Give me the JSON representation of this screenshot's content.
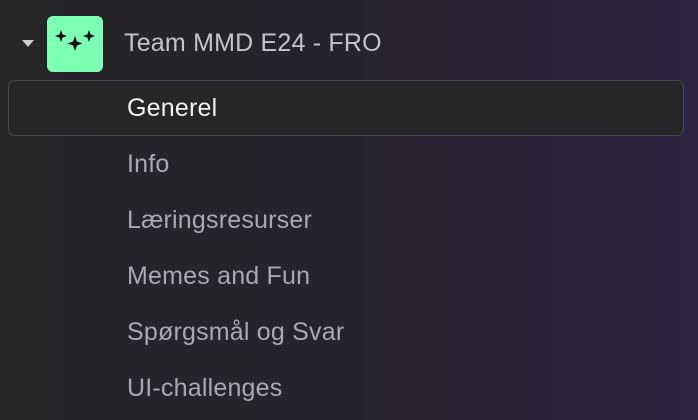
{
  "team": {
    "name": "Team MMD E24 - FRO",
    "avatar_icon": "sparkles-icon",
    "avatar_color": "#7dffb4",
    "expanded": true
  },
  "channels": [
    {
      "label": "Generel",
      "active": true
    },
    {
      "label": "Info",
      "active": false
    },
    {
      "label": "Læringsresurser",
      "active": false
    },
    {
      "label": "Memes and Fun",
      "active": false
    },
    {
      "label": "Spørgsmål og Svar",
      "active": false
    },
    {
      "label": "UI-challenges",
      "active": false
    }
  ],
  "colors": {
    "active_background": "#262628",
    "active_border": "#4a494e",
    "active_text": "#f2f1f4",
    "inactive_text": "#aaa8b0"
  }
}
